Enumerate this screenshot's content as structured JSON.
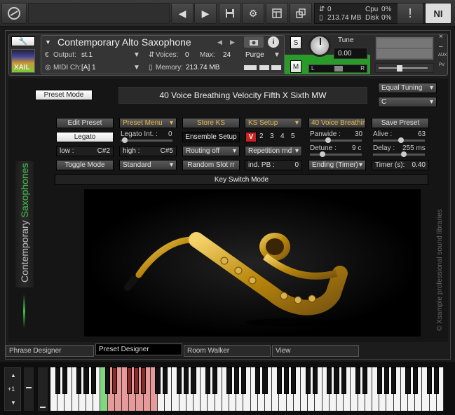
{
  "topbar": {
    "cpu_label": "Cpu",
    "cpu_value": "0%",
    "disk_label": "Disk",
    "disk_value": "0%",
    "voices": "0",
    "memory": "213.74 MB",
    "warning": "!",
    "ni_logo": "NI"
  },
  "header": {
    "instrument_name": "Contemporary Alto Saxophone",
    "output_label": "Output:",
    "output_value": "st.1",
    "voices_label": "Voices:",
    "voices_value": "0",
    "max_label": "Max:",
    "max_value": "24",
    "midi_label": "MIDI Ch:",
    "midi_value": "[A]  1",
    "memory_label": "Memory:",
    "memory_value": "213.74 MB",
    "purge_label": "Purge",
    "tune_label": "Tune",
    "tune_value": "0.00",
    "solo_label": "S",
    "mute_label": "M",
    "logo_text": "XAIL",
    "aux_label": "AUX",
    "pv_label": "PV",
    "pan_left": "L",
    "pan_right": "R"
  },
  "main": {
    "preset_mode": "Preset Mode",
    "preset_display": "40 Voice Breathing Velocity Fifth X Sixth MW",
    "tuning": "Equal Tuning",
    "key": "C",
    "row1": {
      "edit_preset": "Edit Preset",
      "preset_menu": "Preset Menu",
      "store_ks": "Store KS",
      "ks_setup": "KS Setup",
      "preset_name_short": "40 Voice Breathing",
      "save_preset": "Save Preset"
    },
    "row2": {
      "legato": "Legato",
      "legato_int_label": "Legato Int. :",
      "legato_int_value": "0",
      "ensemble_setup": "Ensemble Setup",
      "slots": [
        "V",
        "2",
        "3",
        "4",
        "5"
      ],
      "panwide_label": "Panwide :",
      "panwide_value": "30",
      "alive_label": "Alive :",
      "alive_value": "63"
    },
    "row3": {
      "low_label": "low :",
      "low_value": "C#2",
      "high_label": "high :",
      "high_value": "C#5",
      "routing": "Routing off",
      "repetition": "Repetition rnd",
      "detune_label": "Detune :",
      "detune_value": "9 c",
      "delay_label": "Delay :",
      "delay_value": "255 ms"
    },
    "row4": {
      "toggle_mode": "Toggle Mode",
      "standard": "Standard",
      "random_slot": "Random Slot rr",
      "ind_pb_label": "ind. PB :",
      "ind_pb_value": "0",
      "ending": "Ending (Timer)",
      "timer_label": "Timer (s):",
      "timer_value": "0.40"
    },
    "keyswitch_mode": "Key Switch Mode",
    "side_title_1": "Contemporary",
    "side_title_2": "Saxophones",
    "copyright": "© Xsample professional sound libraries"
  },
  "tabs": [
    "Phrase Designer",
    "Preset Designer",
    "Room Walker",
    "View"
  ],
  "keyboard": {
    "octave_label": "+1"
  },
  "colors": {
    "accent_orange": "#e8b84a",
    "accent_green": "#3fbf4a",
    "red": "#cc2222"
  }
}
